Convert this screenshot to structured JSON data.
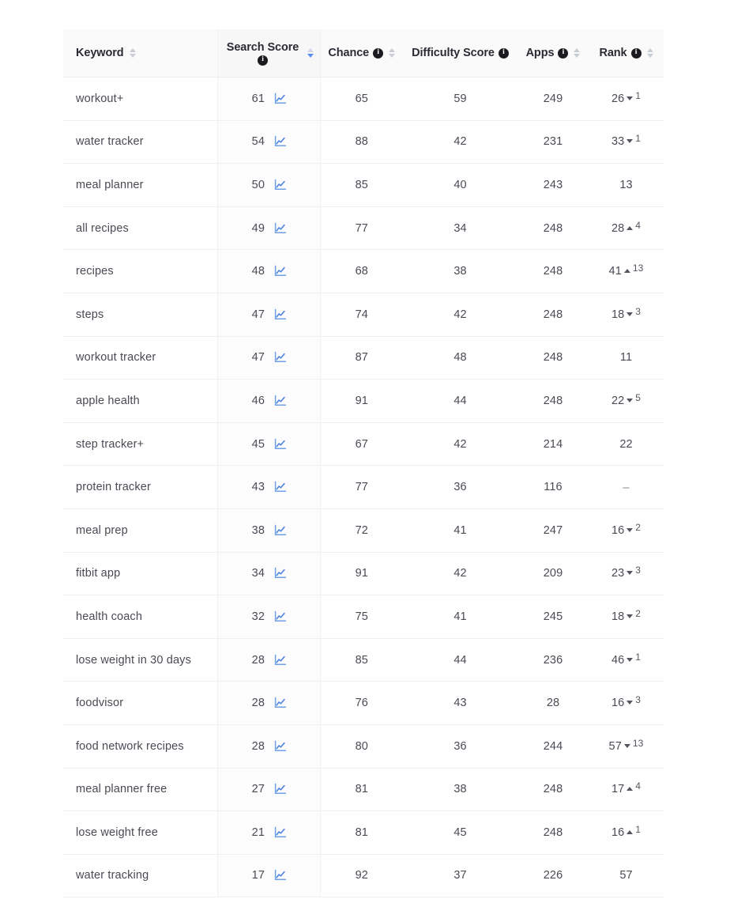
{
  "table": {
    "columns": [
      {
        "key": "keyword",
        "label": "Keyword",
        "has_info": false,
        "sortable": true,
        "sort_active": false,
        "align": "left"
      },
      {
        "key": "score",
        "label": "Search Score",
        "has_info": true,
        "sortable": true,
        "sort_active": true,
        "align": "center"
      },
      {
        "key": "chance",
        "label": "Chance",
        "has_info": true,
        "sortable": true,
        "sort_active": false,
        "align": "center"
      },
      {
        "key": "difficulty",
        "label": "Difficulty Score",
        "has_info": true,
        "sortable": false,
        "sort_active": false,
        "align": "center"
      },
      {
        "key": "apps",
        "label": "Apps",
        "has_info": true,
        "sortable": true,
        "sort_active": false,
        "align": "center"
      },
      {
        "key": "rank",
        "label": "Rank",
        "has_info": true,
        "sortable": true,
        "sort_active": false,
        "align": "center"
      }
    ],
    "icons": {
      "info": "info-icon",
      "sort": "sort-arrows-icon",
      "trend_chart": "line-chart-icon",
      "rank_up": "triangle-up-icon",
      "rank_down": "triangle-down-icon"
    },
    "rank_placeholder": "–",
    "rows": [
      {
        "keyword": "workout+",
        "score": "61",
        "chance": "65",
        "difficulty": "59",
        "apps": "249",
        "rank": "26",
        "rank_dir": "down",
        "rank_delta": "1"
      },
      {
        "keyword": "water tracker",
        "score": "54",
        "chance": "88",
        "difficulty": "42",
        "apps": "231",
        "rank": "33",
        "rank_dir": "down",
        "rank_delta": "1"
      },
      {
        "keyword": "meal planner",
        "score": "50",
        "chance": "85",
        "difficulty": "40",
        "apps": "243",
        "rank": "13",
        "rank_dir": "none",
        "rank_delta": ""
      },
      {
        "keyword": "all recipes",
        "score": "49",
        "chance": "77",
        "difficulty": "34",
        "apps": "248",
        "rank": "28",
        "rank_dir": "up",
        "rank_delta": "4"
      },
      {
        "keyword": "recipes",
        "score": "48",
        "chance": "68",
        "difficulty": "38",
        "apps": "248",
        "rank": "41",
        "rank_dir": "up",
        "rank_delta": "13"
      },
      {
        "keyword": "steps",
        "score": "47",
        "chance": "74",
        "difficulty": "42",
        "apps": "248",
        "rank": "18",
        "rank_dir": "down",
        "rank_delta": "3"
      },
      {
        "keyword": "workout tracker",
        "score": "47",
        "chance": "87",
        "difficulty": "48",
        "apps": "248",
        "rank": "11",
        "rank_dir": "none",
        "rank_delta": ""
      },
      {
        "keyword": "apple health",
        "score": "46",
        "chance": "91",
        "difficulty": "44",
        "apps": "248",
        "rank": "22",
        "rank_dir": "down",
        "rank_delta": "5"
      },
      {
        "keyword": "step tracker+",
        "score": "45",
        "chance": "67",
        "difficulty": "42",
        "apps": "214",
        "rank": "22",
        "rank_dir": "none",
        "rank_delta": ""
      },
      {
        "keyword": "protein tracker",
        "score": "43",
        "chance": "77",
        "difficulty": "36",
        "apps": "116",
        "rank": "",
        "rank_dir": "none",
        "rank_delta": ""
      },
      {
        "keyword": "meal prep",
        "score": "38",
        "chance": "72",
        "difficulty": "41",
        "apps": "247",
        "rank": "16",
        "rank_dir": "down",
        "rank_delta": "2"
      },
      {
        "keyword": "fitbit app",
        "score": "34",
        "chance": "91",
        "difficulty": "42",
        "apps": "209",
        "rank": "23",
        "rank_dir": "down",
        "rank_delta": "3"
      },
      {
        "keyword": "health coach",
        "score": "32",
        "chance": "75",
        "difficulty": "41",
        "apps": "245",
        "rank": "18",
        "rank_dir": "down",
        "rank_delta": "2"
      },
      {
        "keyword": "lose weight in 30 days",
        "score": "28",
        "chance": "85",
        "difficulty": "44",
        "apps": "236",
        "rank": "46",
        "rank_dir": "down",
        "rank_delta": "1"
      },
      {
        "keyword": "foodvisor",
        "score": "28",
        "chance": "76",
        "difficulty": "43",
        "apps": "28",
        "rank": "16",
        "rank_dir": "down",
        "rank_delta": "3"
      },
      {
        "keyword": "food network recipes",
        "score": "28",
        "chance": "80",
        "difficulty": "36",
        "apps": "244",
        "rank": "57",
        "rank_dir": "down",
        "rank_delta": "13"
      },
      {
        "keyword": "meal planner free",
        "score": "27",
        "chance": "81",
        "difficulty": "38",
        "apps": "248",
        "rank": "17",
        "rank_dir": "up",
        "rank_delta": "4"
      },
      {
        "keyword": "lose weight free",
        "score": "21",
        "chance": "81",
        "difficulty": "45",
        "apps": "248",
        "rank": "16",
        "rank_dir": "up",
        "rank_delta": "1"
      },
      {
        "keyword": "water tracking",
        "score": "17",
        "chance": "92",
        "difficulty": "37",
        "apps": "226",
        "rank": "57",
        "rank_dir": "none",
        "rank_delta": ""
      }
    ]
  },
  "colors": {
    "accent": "#5b8def",
    "header_bg": "#fafafa",
    "score_col_bg": "#fcfcfd",
    "text": "#4a4a55",
    "border": "#f0f0f2"
  }
}
